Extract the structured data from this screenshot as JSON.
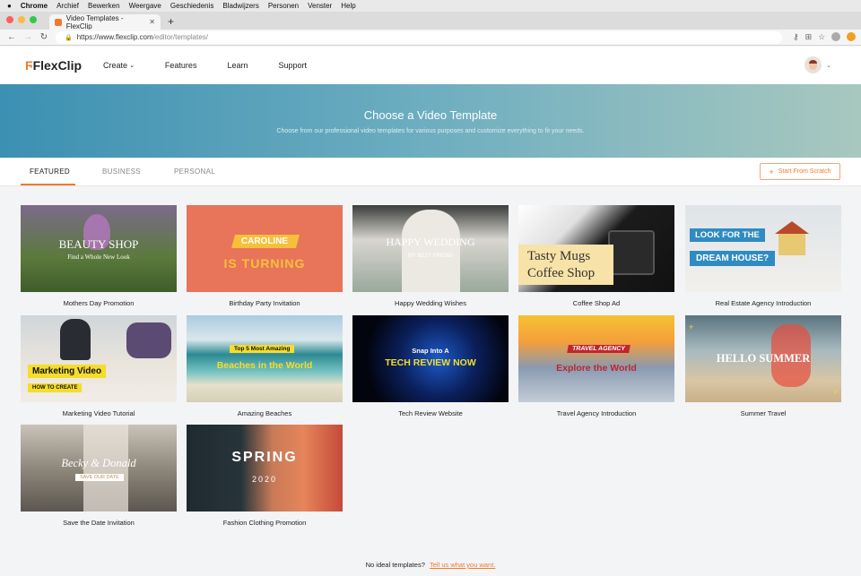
{
  "os_menu": {
    "apple": "",
    "app": "Chrome",
    "items": [
      "Archief",
      "Bewerken",
      "Weergave",
      "Geschiedenis",
      "Bladwijzers",
      "Personen",
      "Venster",
      "Help"
    ]
  },
  "browser": {
    "tab_title": "Video Templates - FlexClip",
    "url_host": "https://www.flexclip.com",
    "url_path": "/editor/templates/"
  },
  "header": {
    "logo": "FlexClip",
    "nav": [
      {
        "label": "Create"
      },
      {
        "label": "Features"
      },
      {
        "label": "Learn"
      },
      {
        "label": "Support"
      }
    ]
  },
  "hero": {
    "title": "Choose a Video Template",
    "subtitle": "Choose from our professional video templates for various purposes and customize everything to fit your needs."
  },
  "categories": [
    "FEATURED",
    "BUSINESS",
    "PERSONAL"
  ],
  "active_category": "FEATURED",
  "scratch_button": "Start From Scratch",
  "templates": [
    {
      "name": "Mothers Day Promotion",
      "t1": "BEAUTY SHOP",
      "t2": "Find a Whole New Look"
    },
    {
      "name": "Birthday Party Invitation",
      "t1": "CAROLINE",
      "t2": "IS TURNING"
    },
    {
      "name": "Happy Wedding Wishes",
      "t1": "HAPPY WEDDING",
      "t2": "MY BEST FRIEND"
    },
    {
      "name": "Coffee Shop Ad",
      "t1": "Tasty Mugs",
      "t2": "Coffee Shop"
    },
    {
      "name": "Real Estate Agency Introduction",
      "t1": "LOOK FOR THE",
      "t2": "DREAM HOUSE?"
    },
    {
      "name": "Marketing Video Tutorial",
      "t1": "Marketing Video",
      "t2": "HOW TO CREATE"
    },
    {
      "name": "Amazing Beaches",
      "t1": "Top 5 Most Amazing",
      "t2": "Beaches in the World"
    },
    {
      "name": "Tech Review Website",
      "t1": "Snap Into A",
      "t2": "TECH REVIEW NOW"
    },
    {
      "name": "Travel Agency Introduction",
      "t1": "TRAVEL AGENCY",
      "t2": "Explore the World"
    },
    {
      "name": "Summer Travel",
      "t1": "HELLO SUMMER",
      "t2": ""
    },
    {
      "name": "Save the Date Invitation",
      "t1": "Becky & Donald",
      "t2": "SAVE OUR DATE"
    },
    {
      "name": "Fashion Clothing Promotion",
      "t1": "SPRING",
      "t2": "2020"
    }
  ],
  "footer": {
    "text": "No ideal templates?",
    "link": "Tell us what you want."
  },
  "colors": {
    "accent": "#f07b2a",
    "hero_start": "#3c90b2",
    "hero_end": "#a8c8bf"
  }
}
